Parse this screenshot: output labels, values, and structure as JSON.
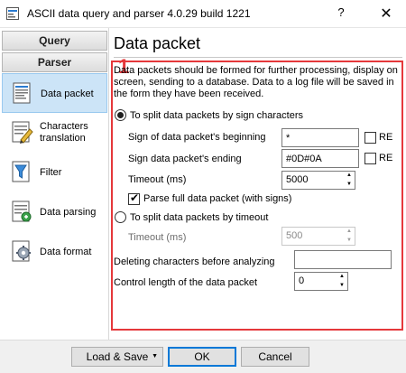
{
  "window": {
    "title": "ASCII data query and parser 4.0.29 build 1221",
    "help_glyph": "?",
    "close_glyph": "✕"
  },
  "sidebar": {
    "headers": [
      {
        "label": "Query"
      },
      {
        "label": "Parser"
      }
    ],
    "items": [
      {
        "label": "Data packet",
        "icon": "data-packet-icon",
        "selected": true
      },
      {
        "label": "Characters translation",
        "icon": "characters-translation-icon"
      },
      {
        "label": "Filter",
        "icon": "filter-icon"
      },
      {
        "label": "Data parsing",
        "icon": "data-parsing-icon"
      },
      {
        "label": "Data format",
        "icon": "data-format-icon"
      }
    ]
  },
  "main": {
    "title": "Data packet",
    "annotation_mark": "1",
    "description": "Data packets should be formed for further processing, display on screen, sending to a database. Data to a log file will be saved in the form they have been received.",
    "split_by_sign": {
      "label": "To split data packets by sign characters",
      "checked": true,
      "begin_label": "Sign of data packet's beginning",
      "begin_value": "*",
      "begin_re": "RE",
      "end_label": "Sign data packet's ending",
      "end_value": "#0D#0A",
      "end_re": "RE",
      "timeout_label": "Timeout (ms)",
      "timeout_value": "5000",
      "parse_full_label": "Parse full data packet (with signs)",
      "parse_full_checked": true
    },
    "split_by_timeout": {
      "label": "To split data packets by timeout",
      "checked": false,
      "timeout_label": "Timeout (ms)",
      "timeout_value": "500"
    },
    "delete_chars_label": "Deleting characters before analyzing",
    "delete_chars_value": "",
    "control_length_label": "Control length of the data packet",
    "control_length_value": "0"
  },
  "footer": {
    "load_save_label": "Load & Save",
    "ok_label": "OK",
    "cancel_label": "Cancel"
  },
  "colors": {
    "accent_red": "#e5383b",
    "selection": "#cce4f7",
    "primary_border": "#0078d7"
  }
}
